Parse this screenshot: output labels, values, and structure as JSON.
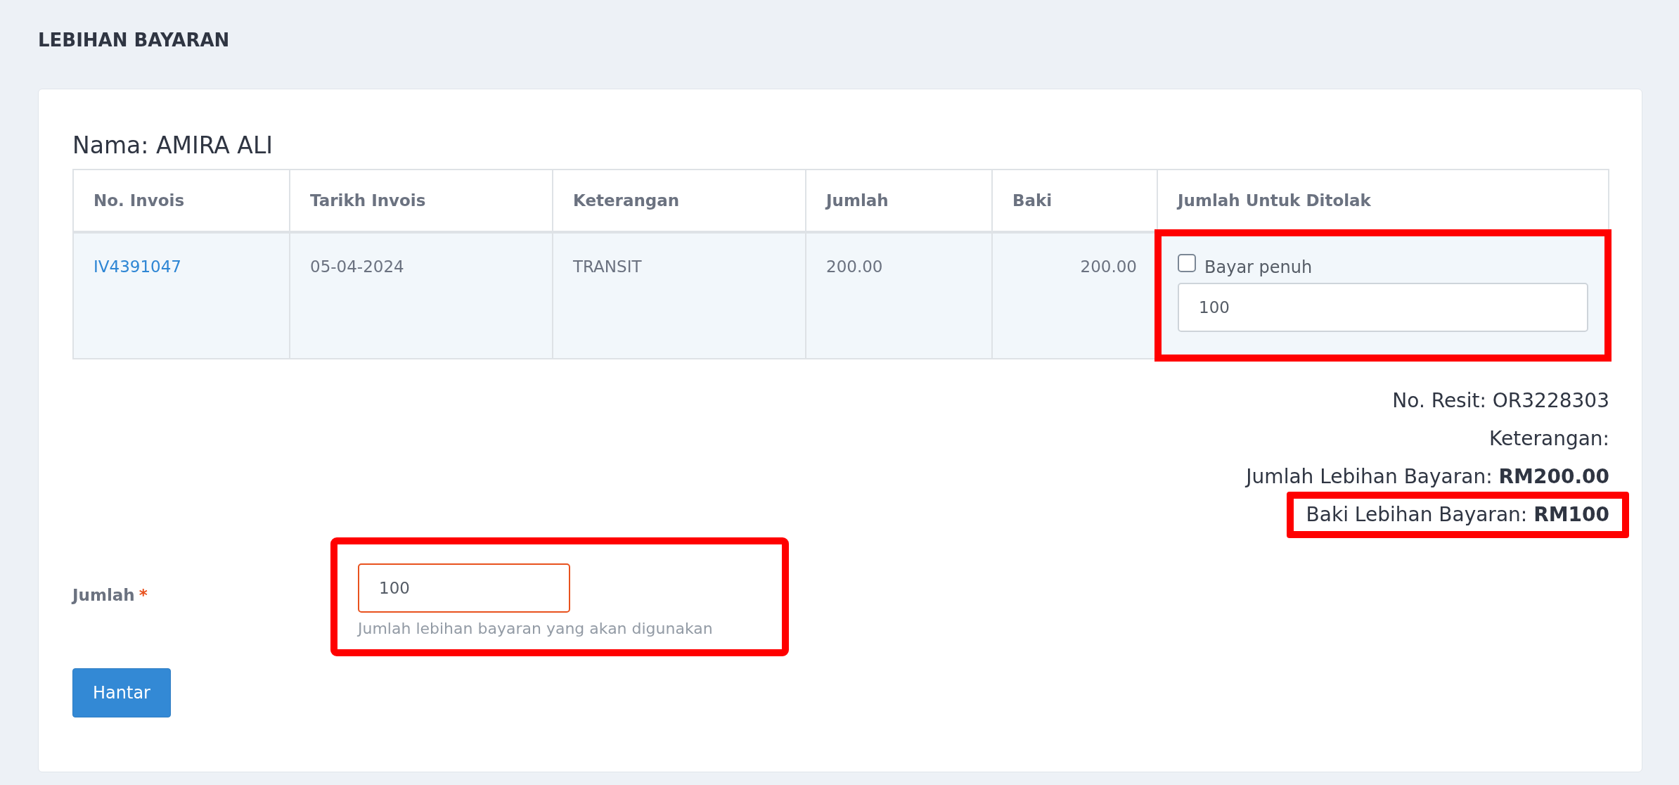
{
  "page_title": "LEBIHAN BAYARAN",
  "name_line": "Nama: AMIRA ALI",
  "table": {
    "columns": [
      "No. Invois",
      "Tarikh Invois",
      "Keterangan",
      "Jumlah",
      "Baki",
      "Jumlah Untuk Ditolak"
    ],
    "rows": [
      {
        "invoice_no": "IV4391047",
        "date": "05-04-2024",
        "description": "TRANSIT",
        "amount": "200.00",
        "balance": "200.00",
        "full_payment": {
          "label": "Bayar penuh",
          "checked": false
        },
        "deduct_value": "100",
        "highlighted": true
      }
    ]
  },
  "summary": [
    {
      "text": "No. Resit: OR3228303",
      "highlighted": false
    },
    {
      "text": "Keterangan:",
      "highlighted": false
    },
    {
      "text": "Jumlah Lebihan Bayaran: **RM200.00**",
      "highlighted": false
    },
    {
      "text": "Baki Lebihan Bayaran: **RM100**",
      "highlighted": true
    }
  ],
  "amount_field": {
    "label": "Jumlah",
    "required_mark": "*",
    "value": "100",
    "help": "Jumlah lebihan bayaran yang akan digunakan",
    "highlighted": true
  },
  "submit_button": "Hantar"
}
